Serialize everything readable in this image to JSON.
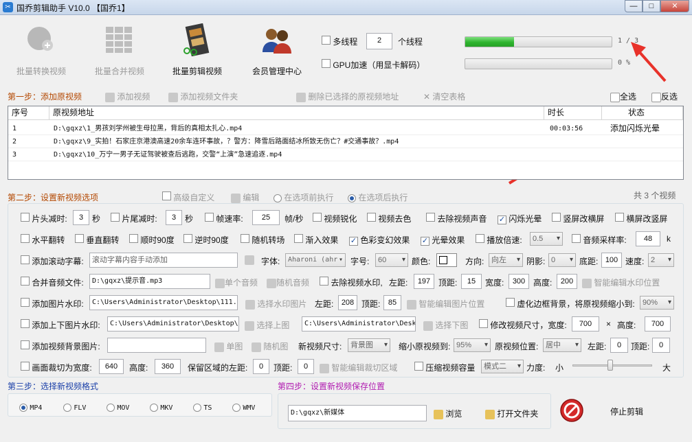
{
  "window": {
    "title": "国乔剪辑助手 V10.0 【国乔1】",
    "min": "—",
    "max": "□",
    "close": "✕"
  },
  "toolbar": {
    "convert": "批量转换视频",
    "merge": "批量合并视频",
    "edit": "批量剪辑视频",
    "members": "会员管理中心"
  },
  "threads": {
    "multi_label": "多线程",
    "count": "2",
    "unit": "个线程",
    "gpu_label": "GPU加速（用显卡解码）"
  },
  "progress": {
    "main": {
      "text": "1 / 3",
      "fraction": 0.333
    },
    "sub": {
      "text": "0 %",
      "fraction": 0
    }
  },
  "step1": {
    "title": "第一步：添加原视频",
    "add_video": "添加视频",
    "add_folder": "添加视频文件夹",
    "delete_selected": "删除已选择的原视频地址",
    "clear_table": "清空表格",
    "select_all": "全选",
    "invert": "反选"
  },
  "table": {
    "headers": {
      "index": "序号",
      "path": "原视频地址",
      "duration": "时长",
      "status": "状态"
    },
    "rows": [
      {
        "index": "1",
        "path": "D:\\gqxz\\1_男孩刘学州被生母拉黑，背后的真相太扎心.mp4",
        "duration": "00:03:56",
        "status": "添加闪烁光晕"
      },
      {
        "index": "2",
        "path": "D:\\gqxz\\9_实拍！石家庄京港澳高速20余车连环事故，？警方：降雪后路面结冰所致无伤亡？#交通事故？.mp4",
        "duration": "",
        "status": ""
      },
      {
        "index": "3",
        "path": "D:\\gqxz\\10_万宁一男子无证驾驶被查后逃跑，交警“上演”急速追逐.mp4",
        "duration": "",
        "status": ""
      }
    ]
  },
  "step2": {
    "title": "第二步：设置新视频选项",
    "advanced": "高级自定义",
    "edit": "编辑",
    "before": "在选项前执行",
    "after": "在选项后执行",
    "count": "共 3 个视频"
  },
  "opts": {
    "r1": {
      "head_cut": "片头减时:",
      "head_val": "3",
      "sec1": "秒",
      "tail_cut": "片尾减时:",
      "tail_val": "3",
      "sec2": "秒",
      "fps": "帧速率:",
      "fps_val": "25",
      "fps_unit": "帧/秒",
      "sharpen": "视频锐化",
      "decolor": "视频去色",
      "mute": "去除视频声音",
      "flash": "闪烁光晕",
      "v2h": "竖屏改横屏",
      "h2v": "横屏改竖屏"
    },
    "r2": {
      "hflip": "水平翻转",
      "vflip": "垂直翻转",
      "cw90": "顺时90度",
      "ccw90": "逆时90度",
      "random_trans": "随机转场",
      "fade_in": "渐入效果",
      "color": "色彩变幻效果",
      "halo": "光晕效果",
      "speed": "播放倍速:",
      "speed_val": "0.5",
      "sample": "音频采样率:",
      "sample_val": "48",
      "k": "k"
    },
    "r3": {
      "scroll": "添加滚动字幕:",
      "scroll_ph": "滚动字幕内容手动添加",
      "font": "字体:",
      "font_val": "Aharoni (ahr",
      "size": "字号:",
      "size_val": "60",
      "color": "颜色:",
      "dir": "方向:",
      "dir_val": "向左",
      "shadow": "阴影:",
      "shadow_val": "0",
      "bottom": "底距:",
      "bottom_val": "100",
      "spd": "速度:",
      "spd_val": "2"
    },
    "r4": {
      "merge_audio": "合并音频文件:",
      "audio_path": "D:\\gqxz\\提示音.mp3",
      "single_audio": "单个音频",
      "random_audio": "随机音频",
      "remove_wm": "去除视频水印,",
      "left": "左距:",
      "left_val": "197",
      "top": "顶距:",
      "top_val": "15",
      "w": "宽度:",
      "w_val": "300",
      "h": "高度:",
      "h_val": "200",
      "smart_wm": "智能编辑水印位置"
    },
    "r5": {
      "img_wm": "添加图片水印:",
      "img_path": "C:\\Users\\Administrator\\Desktop\\111.j",
      "choose_img": "选择水印图片",
      "left": "左距:",
      "left_val": "208",
      "top": "顶距:",
      "top_val": "85",
      "smart_img": "智能编辑图片位置",
      "blur_bg": "虚化边框背景，将原视频缩小到:",
      "blur_val": "90%"
    },
    "r6": {
      "updown": "添加上下图片水印:",
      "up_path": "C:\\Users\\Administrator\\Desktop\\i",
      "choose_up": "选择上图",
      "down_path": "C:\\Users\\Administrator\\Desk",
      "choose_down": "选择下图",
      "resize": "修改视频尺寸，宽度:",
      "w_val": "700",
      "x": "×",
      "h": "高度:",
      "h_val": "700"
    },
    "r7": {
      "bg_img": "添加视频背景图片:",
      "single": "单图",
      "random": "随机图",
      "new_size": "新视频尺寸:",
      "new_size_val": "背景图",
      "shrink": "缩小原视频到:",
      "shrink_val": "95%",
      "pos": "原视频位置:",
      "pos_val": "居中",
      "left": "左距:",
      "left_val": "0",
      "top": "顶距:",
      "top_val": "0"
    },
    "r8": {
      "crop": "画面裁切为宽度:",
      "w_val": "640",
      "h": "高度:",
      "h_val": "360",
      "keep_left": "保留区域的左距:",
      "left_val": "0",
      "top": "顶距:",
      "top_val": "0",
      "smart_crop": "智能编辑裁切区域",
      "compress": "压缩视频容量",
      "mode_val": "模式二",
      "strength": "力度:",
      "small": "小",
      "large": "大"
    }
  },
  "step3": {
    "title": "第三步：选择新视频格式",
    "formats": [
      "MP4",
      "FLV",
      "MOV",
      "MKV",
      "TS",
      "WMV"
    ]
  },
  "step4": {
    "title": "第四步：设置新视频保存位置",
    "path": "D:\\gqxz\\新媒体",
    "browse": "浏览",
    "open_folder": "打开文件夹",
    "stop": "停止剪辑"
  },
  "colors": {
    "progress_green": "#2fb42f",
    "arrow_red": "#e8322a",
    "step_orange": "#b34700",
    "step_blue": "#1a3fa8",
    "step_purple": "#b01ab0"
  }
}
